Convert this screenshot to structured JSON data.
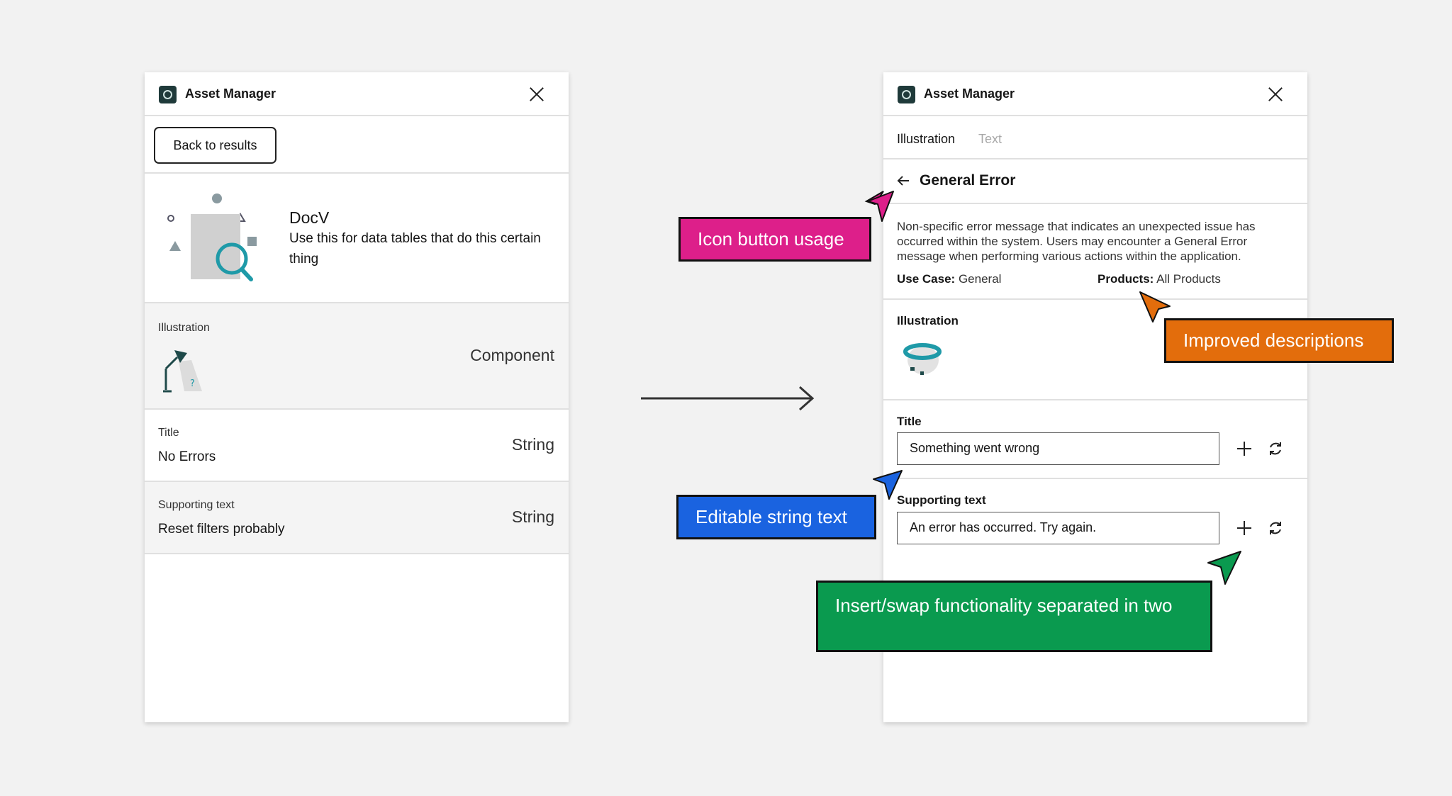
{
  "left_panel": {
    "title": "Asset Manager",
    "back_label": "Back to results",
    "asset": {
      "name": "DocV",
      "description": "Use this for data tables that do this certain thing"
    },
    "illustration": {
      "label": "Illustration",
      "type": "Component"
    },
    "title_field": {
      "label": "Title",
      "value": "No Errors",
      "type": "String"
    },
    "supporting_field": {
      "label": "Supporting text",
      "value": "Reset filters probably",
      "type": "String"
    }
  },
  "right_panel": {
    "title": "Asset Manager",
    "tabs": [
      {
        "label": "Illustration",
        "active": true
      },
      {
        "label": "Text",
        "active": false
      }
    ],
    "detail_title": "General Error",
    "description": "Non-specific error message that indicates an unexpected issue has occurred within the system. Users may encounter a General Error message when performing various actions within the application.",
    "use_case_label": "Use Case:",
    "use_case_value": "General",
    "products_label": "Products:",
    "products_value": "All Products",
    "illustration_label": "Illustration",
    "title_label": "Title",
    "title_value": "Something went wrong",
    "supporting_label": "Supporting text",
    "supporting_value": "An error has occurred. Try again."
  },
  "callouts": {
    "icon_button": "Icon button usage",
    "descriptions": "Improved descriptions",
    "editable": "Editable string text",
    "insert_swap": "Insert/swap functionality separated in two"
  },
  "colors": {
    "pink": "#dd1f8a",
    "orange": "#e36d0c",
    "blue": "#1a63e0",
    "green": "#0a9a4f",
    "teal_icon": "#1f9aa8"
  }
}
